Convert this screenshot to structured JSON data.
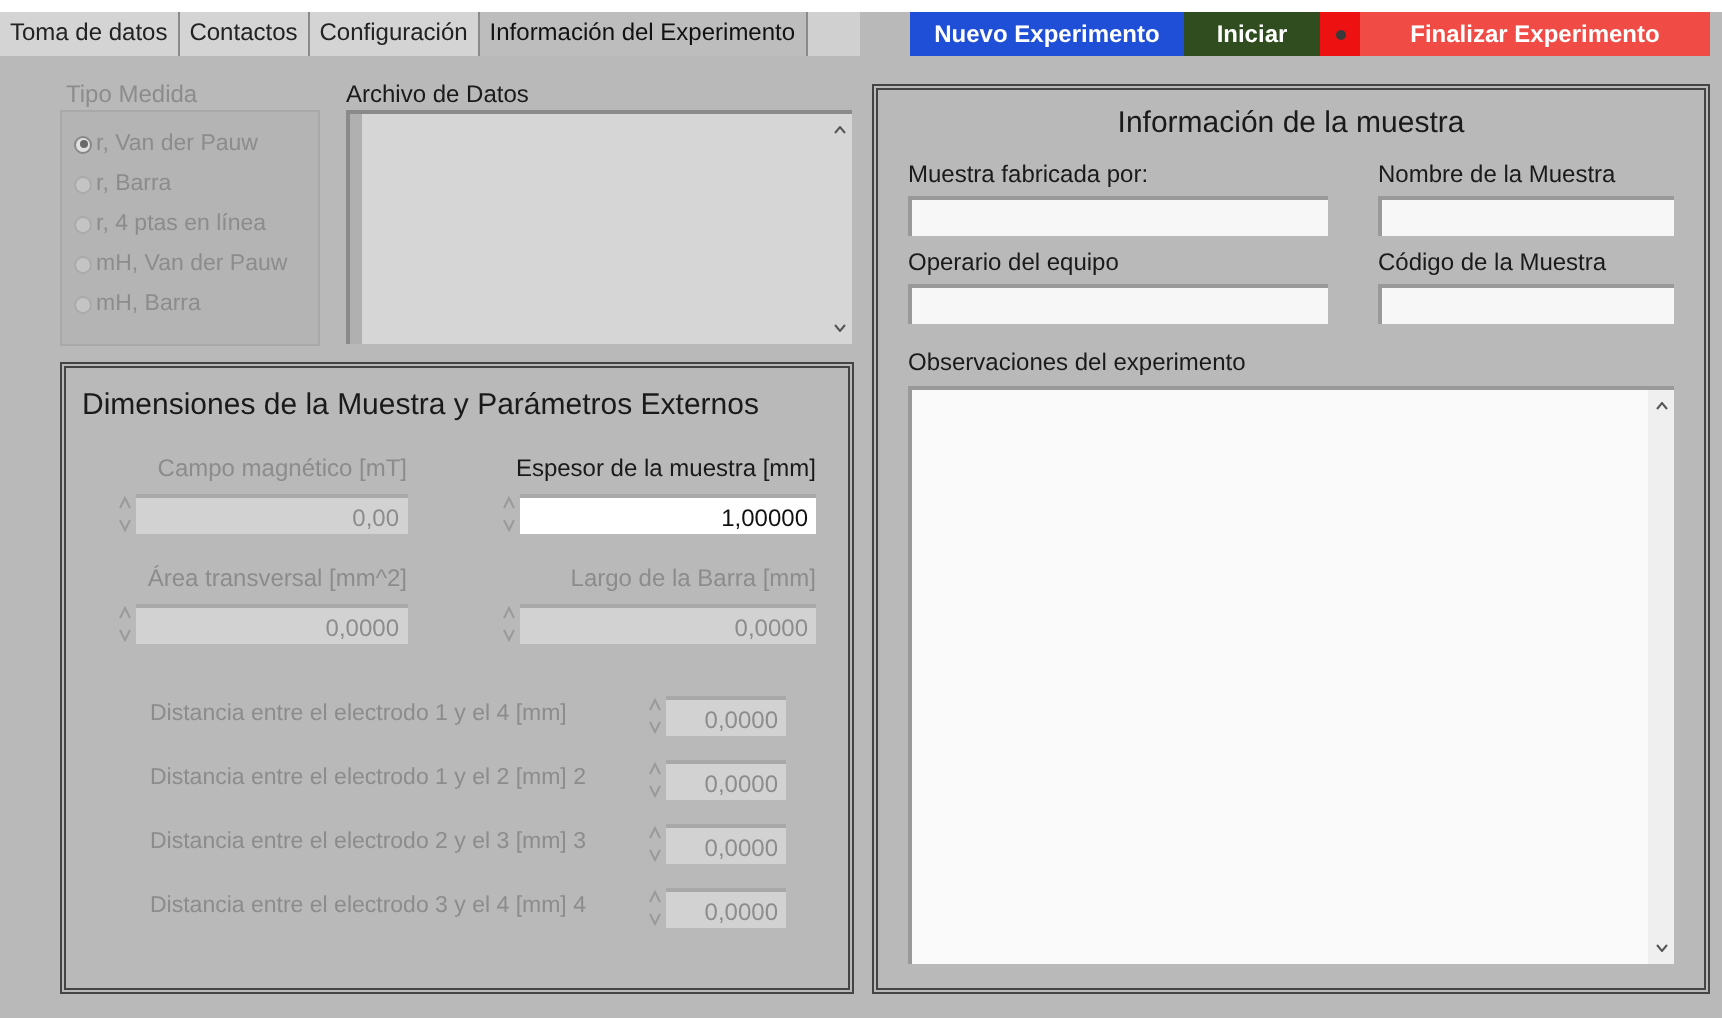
{
  "tabs": [
    {
      "label": "Toma de datos",
      "selected": false
    },
    {
      "label": "Contactos",
      "selected": false
    },
    {
      "label": "Configuración",
      "selected": false
    },
    {
      "label": "Información del Experimento",
      "selected": true
    }
  ],
  "buttons": [
    {
      "label": "Nuevo Experimento",
      "kind": "new"
    },
    {
      "label": "Iniciar",
      "kind": "start"
    },
    {
      "label": "Finalizar Experimento",
      "kind": "finish"
    }
  ],
  "indicator": {
    "on": true
  },
  "tipo_medida": {
    "label": "Tipo Medida",
    "disabled": true,
    "options": [
      {
        "label": "r, Van der Pauw",
        "selected": true
      },
      {
        "label": "r, Barra",
        "selected": false
      },
      {
        "label": "r, 4 ptas en línea",
        "selected": false
      },
      {
        "label": "mH, Van der Pauw",
        "selected": false
      },
      {
        "label": "mH, Barra",
        "selected": false
      }
    ]
  },
  "archivo_de_datos": {
    "label": "Archivo de Datos"
  },
  "dimensiones": {
    "title": "Dimensiones de la Muestra y Parámetros Externos",
    "fields": [
      {
        "label": "Campo magnético [mT]",
        "value": "0,00",
        "disabled": true
      },
      {
        "label": "Espesor de la muestra [mm]",
        "value": "1,00000",
        "disabled": false
      },
      {
        "label": "Área transversal [mm^2]",
        "value": "0,0000",
        "disabled": true
      },
      {
        "label": "Largo de la Barra [mm]",
        "value": "0,0000",
        "disabled": true
      }
    ],
    "distances": [
      {
        "label": "Distancia entre el electrodo 1 y el 4 [mm]",
        "value": "0,0000",
        "disabled": true
      },
      {
        "label": "Distancia entre el electrodo 1 y el 2 [mm] 2",
        "value": "0,0000",
        "disabled": true
      },
      {
        "label": "Distancia entre el electrodo 2 y el 3 [mm] 3",
        "value": "0,0000",
        "disabled": true
      },
      {
        "label": "Distancia entre el electrodo 3 y el 4 [mm] 4",
        "value": "0,0000",
        "disabled": true
      }
    ]
  },
  "muestra": {
    "title": "Información de la muestra",
    "fields": [
      {
        "label": "Muestra fabricada por:"
      },
      {
        "label": "Nombre de la Muestra"
      },
      {
        "label": "Operario del equipo"
      },
      {
        "label": "Código de la Muestra"
      }
    ],
    "observaciones": {
      "label": "Observaciones del experimento"
    }
  }
}
